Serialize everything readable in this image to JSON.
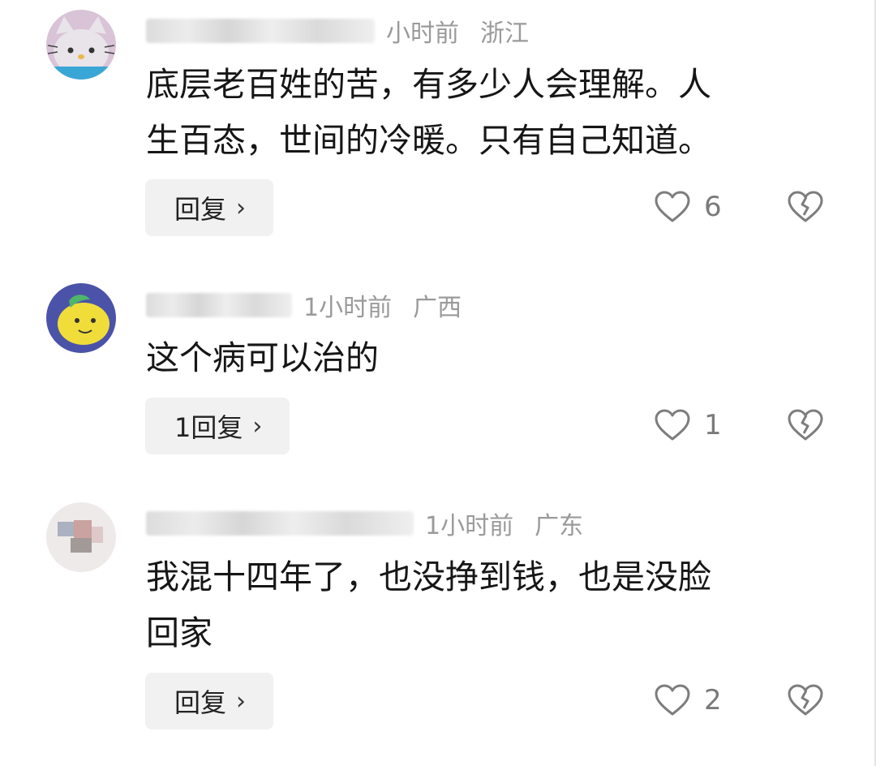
{
  "comments": [
    {
      "time": "小时前",
      "region": "浙江",
      "text_lines": [
        "底层老百姓的苦，有多少人会理解。人",
        "生百态，世间的冷暖。只有自己知道。"
      ],
      "reply_label": "回复",
      "likes": "6",
      "avatar_icon": "hello-kitty-avatar"
    },
    {
      "time": "1小时前",
      "region": "广西",
      "text_lines": [
        "这个病可以治的"
      ],
      "reply_label": "1回复",
      "likes": "1",
      "avatar_icon": "lemon-cartoon-avatar"
    },
    {
      "time": "1小时前",
      "region": "广东",
      "text_lines": [
        "我混十四年了，也没挣到钱，也是没脸",
        "回家"
      ],
      "reply_label": "回复",
      "likes": "2",
      "avatar_icon": "photo-avatar"
    }
  ],
  "icons": {
    "reply_chevron": "›",
    "like": "heart-outline-icon",
    "dislike": "broken-heart-icon"
  },
  "colors": {
    "meta_text": "#9a9a9a",
    "body_text": "#161616",
    "reply_bg": "#f1f1f1",
    "icon_stroke": "#7d7d7d"
  }
}
